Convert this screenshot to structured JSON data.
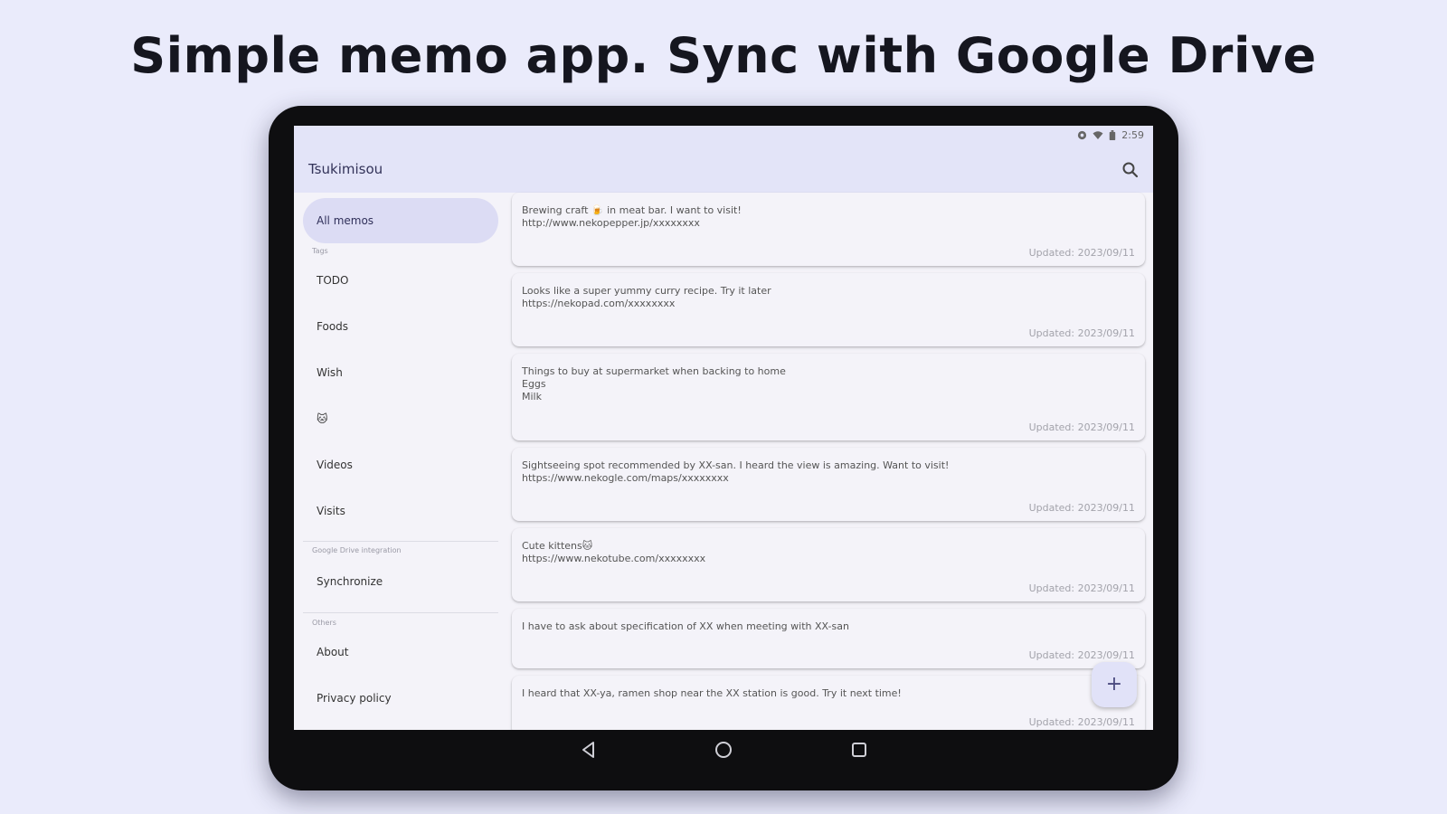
{
  "headline": "Simple memo app. Sync with Google Drive",
  "status_bar": {
    "time": "2:59",
    "icons": [
      "settings-icon",
      "wifi-icon",
      "battery-icon"
    ]
  },
  "app_bar": {
    "title": "Tsukimisou",
    "search_icon": "search-icon"
  },
  "drawer": {
    "all_memos": "All memos",
    "tags_label": "Tags",
    "tags": [
      "TODO",
      "Foods",
      "Wish",
      "🐱",
      "Videos",
      "Visits"
    ],
    "google_drive_label": "Google Drive integration",
    "synchronize": "Synchronize",
    "others_label": "Others",
    "about": "About",
    "privacy_policy": "Privacy policy"
  },
  "memos": [
    {
      "lines": [
        "Brewing craft 🍺 in meat bar. I want to visit!",
        "http://www.nekopepper.jp/xxxxxxxx"
      ],
      "updated": "Updated: 2023/09/11"
    },
    {
      "lines": [
        "Looks like a super yummy curry recipe. Try it later",
        "https://nekopad.com/xxxxxxxx"
      ],
      "updated": "Updated: 2023/09/11"
    },
    {
      "lines": [
        "Things to buy at supermarket when backing to home",
        "Eggs",
        "Milk"
      ],
      "updated": "Updated: 2023/09/11"
    },
    {
      "lines": [
        "Sightseeing spot recommended by XX-san. I heard the view is amazing. Want to visit!",
        "https://www.nekogle.com/maps/xxxxxxxx"
      ],
      "updated": "Updated: 2023/09/11"
    },
    {
      "lines": [
        "Cute kittens🐱",
        "https://www.nekotube.com/xxxxxxxx"
      ],
      "updated": "Updated: 2023/09/11"
    },
    {
      "lines": [
        "I have to ask about specification of XX when meeting with XX-san"
      ],
      "updated": "Updated: 2023/09/11"
    },
    {
      "lines": [
        "I heard that XX-ya, ramen shop near the XX station is good. Try it next time!"
      ],
      "updated": "Updated: 2023/09/11"
    }
  ],
  "fab_label": "+",
  "colors": {
    "accent": "#dcdcf4",
    "app_bar": "#e3e4f8",
    "background": "#eaebfb"
  }
}
